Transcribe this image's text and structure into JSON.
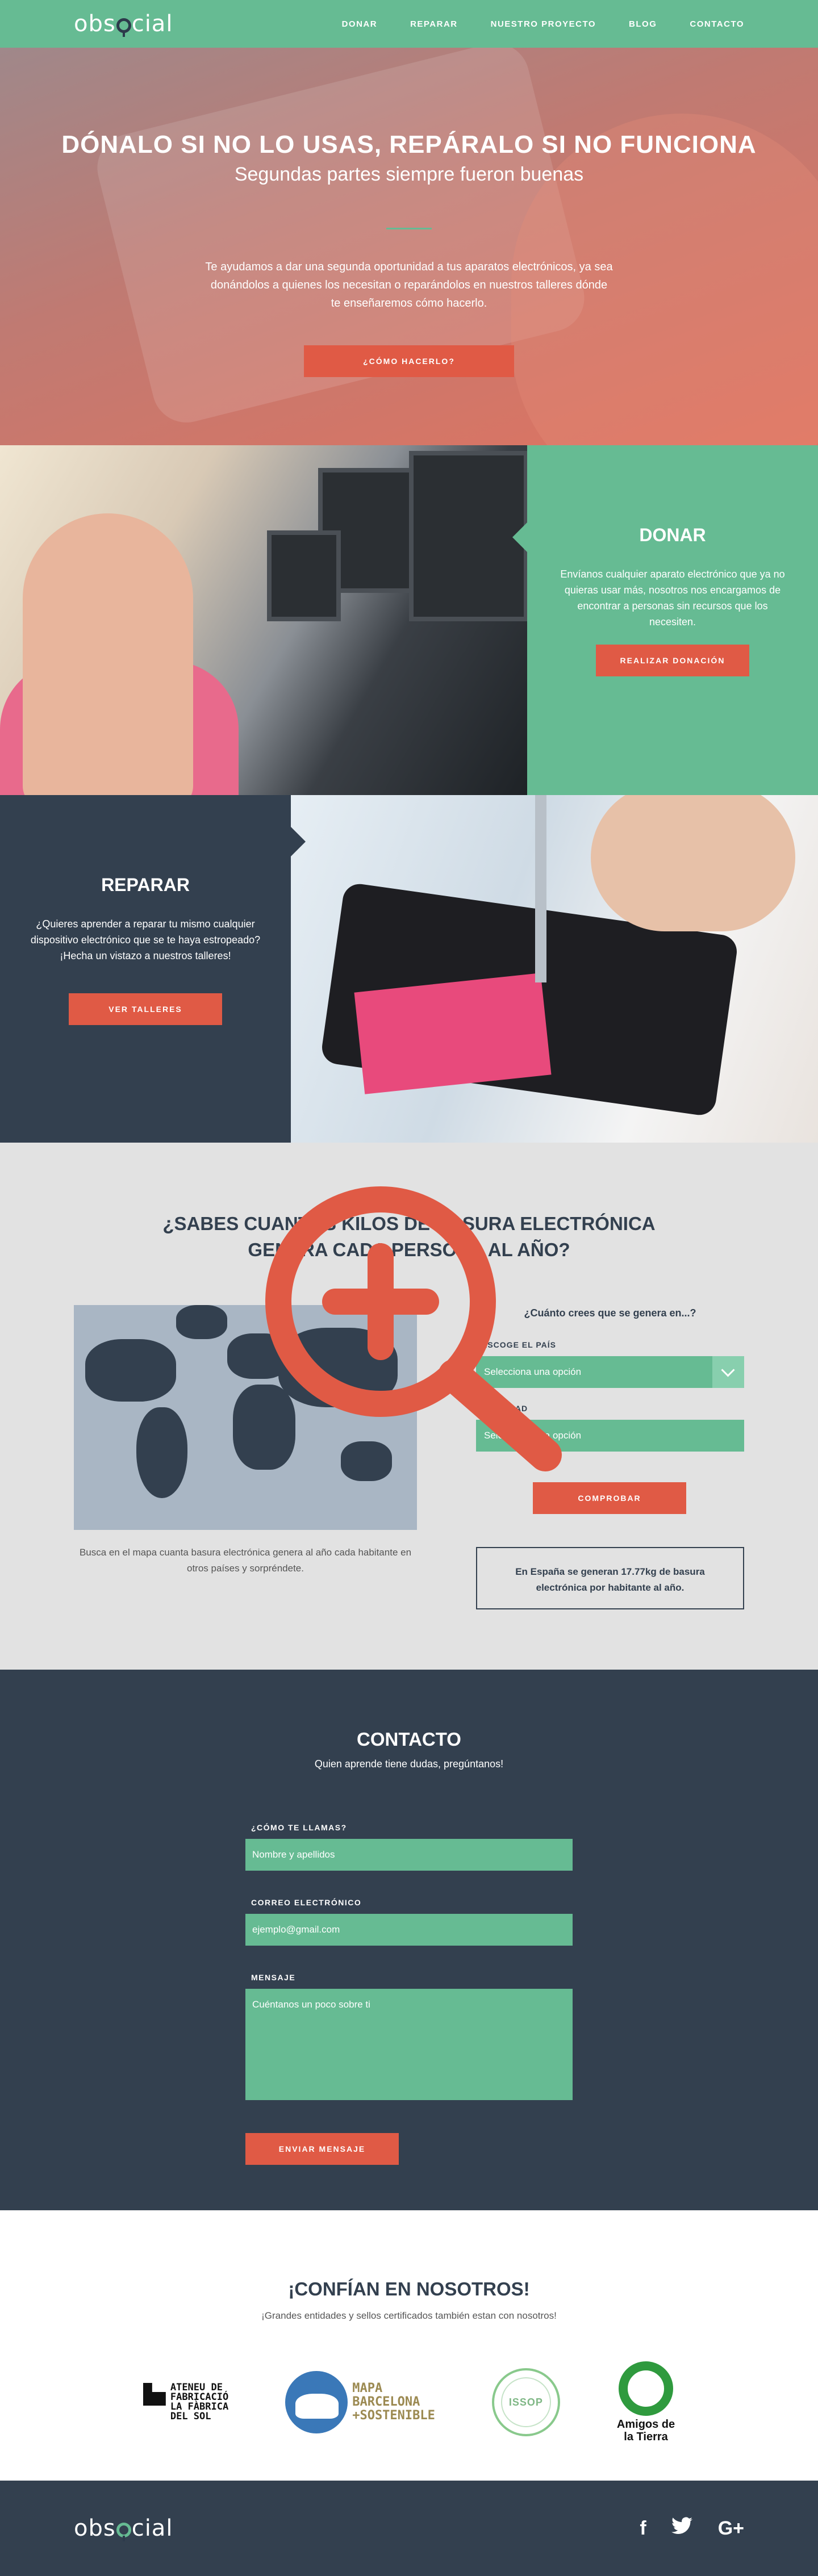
{
  "brand": {
    "logo_pre": "obs",
    "logo_post": "cial"
  },
  "nav": {
    "items": [
      "DONAR",
      "REPARAR",
      "NUESTRO PROYECTO",
      "BLOG",
      "CONTACTO"
    ]
  },
  "hero": {
    "title": "DÓNALO SI NO LO USAS, REPÁRALO SI NO FUNCIONA",
    "subtitle": "Segundas partes siempre fueron buenas",
    "text": "Te ayudamos a dar una segunda oportunidad a tus aparatos electrónicos, ya sea donándolos a quienes los necesitan o reparándolos en nuestros talleres dónde te enseñaremos cómo hacerlo.",
    "cta": "¿CÓMO HACERLO?"
  },
  "donar": {
    "title": "DONAR",
    "text": "Envíanos cualquier aparato electrónico que ya no quieras usar más, nosotros nos encargamos de encontrar a personas sin recursos que los necesiten.",
    "cta": "REALIZAR DONACIÓN"
  },
  "reparar": {
    "title": "REPARAR",
    "text": "¿Quieres aprender a reparar tu mismo cualquier dispositivo electrónico que se te haya estropeado? ¡Hecha un vistazo a nuestros talleres!",
    "cta": "VER TALLERES"
  },
  "quiz": {
    "title_line1": "¿SABES CUANTOS KILOS DE BASURA ELECTRÓNICA",
    "title_line2": "GENERA CADA PERSONA AL AÑO?",
    "map_caption": "Busca en el mapa cuanta basura electrónica genera al año cada habitante en otros países y sorpréndete.",
    "question": "¿Cuánto crees que se genera en...?",
    "country_label": "ESCOGE EL PAÍS",
    "country_placeholder": "Selecciona una opción",
    "amount_label": "CANTIDAD",
    "amount_placeholder": "Selecciona una opción",
    "cta": "COMPROBAR",
    "result": "En España se generan 17.77kg de basura electrónica por habitante al año."
  },
  "contact": {
    "title": "CONTACTO",
    "subtitle": "Quien aprende tiene dudas, pregúntanos!",
    "name_label": "¿CÓMO TE LLAMAS?",
    "name_placeholder": "Nombre y apellidos",
    "email_label": "CORREO ELECTRÓNICO",
    "email_placeholder": "ejemplo@gmail.com",
    "message_label": "MENSAJE",
    "message_placeholder": "Cuéntanos un poco sobre ti",
    "cta": "ENVIAR MENSAJE"
  },
  "trust": {
    "title": "¡CONFÍAN EN NOSOTROS!",
    "subtitle": "¡Grandes entidades y sellos certificados también estan con nosotros!",
    "ateneu": "ATENEU DE\nFABRICACIÓ\nLA FÀBRICA\nDEL SOL",
    "mapa": "MAPA\nBARCELONA\n+SOSTENIBLE",
    "issop": "ISSOP",
    "amigos": "Amigos de\nla Tierra"
  },
  "footer": {
    "social": [
      "f",
      "twitter",
      "G+"
    ]
  },
  "colors": {
    "green": "#66bb93",
    "navy": "#33404f",
    "red": "#e05a45",
    "grey": "#e2e2e2"
  }
}
